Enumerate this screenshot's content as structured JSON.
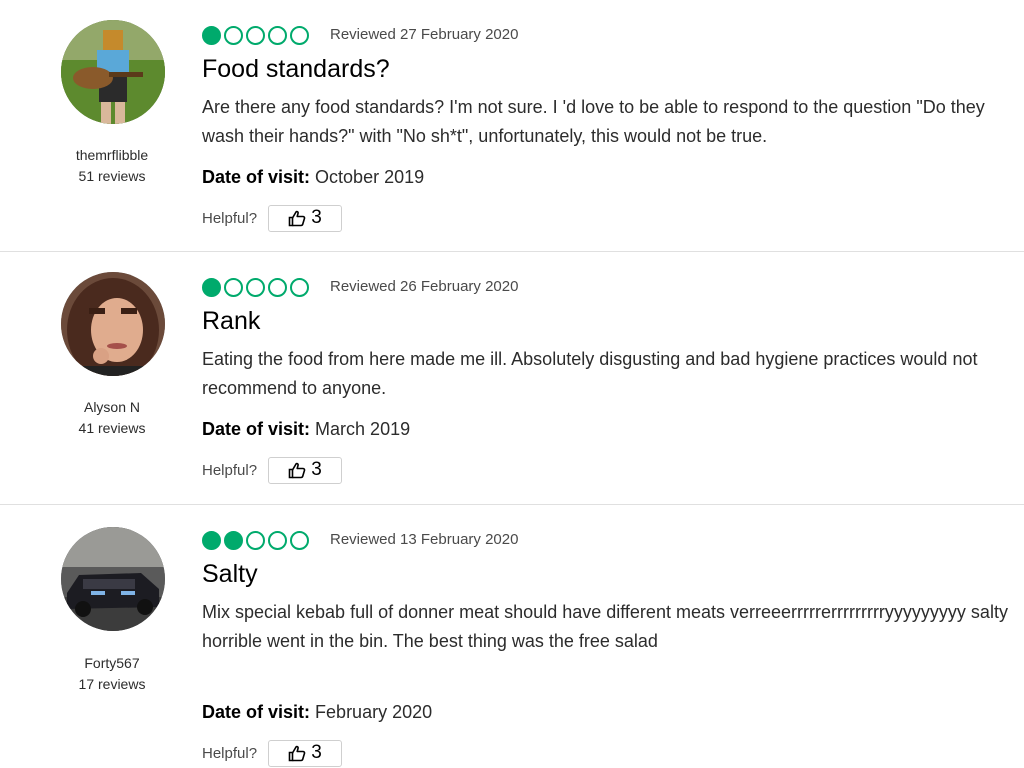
{
  "colors": {
    "bubble": "#00aa6c",
    "separator": "#e0e0e0"
  },
  "labels": {
    "date_of_visit": "Date of visit:",
    "helpful": "Helpful?"
  },
  "reviews": [
    {
      "username": "themrflibble",
      "review_count": "51 reviews",
      "rating": 1,
      "reviewed": "Reviewed 27 February 2020",
      "title": "Food standards?",
      "body": "Are there any food standards? I'm not sure. I 'd love to be able to respond to the question \"Do they wash their hands?\" with \"No sh*t\", unfortunately, this would not be true.",
      "date_of_visit": "October 2019",
      "helpful_count": "3"
    },
    {
      "username": "Alyson N",
      "review_count": "41 reviews",
      "rating": 1,
      "reviewed": "Reviewed 26 February 2020",
      "title": "Rank",
      "body": "Eating the food from here made me ill. Absolutely disgusting and bad hygiene practices would not recommend to anyone.",
      "date_of_visit": "March 2019",
      "helpful_count": "3"
    },
    {
      "username": "Forty567",
      "review_count": "17 reviews",
      "rating": 2,
      "reviewed": "Reviewed 13 February 2020",
      "title": "Salty",
      "body": "Mix special kebab full of donner meat should have different meats verreeerrrrrerrrrrrrrryyyyyyyyy salty horrible went in the bin. The best thing was the free salad",
      "date_of_visit": "February 2020",
      "helpful_count": "3"
    }
  ]
}
